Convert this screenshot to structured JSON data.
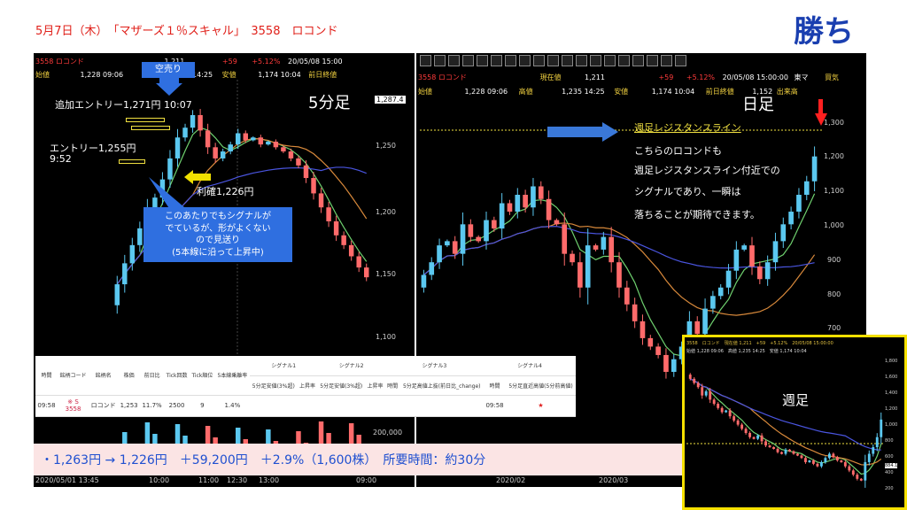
{
  "title": "5月7日（木）　「マザーズ１％スキャル」　3558　ロコンド",
  "verdict": "勝ち",
  "five_min_panel": {
    "label": "5分足",
    "header": {
      "code": "3558",
      "name": "ロコンド",
      "open_label": "始値",
      "open": "1,228 09:06",
      "price": "1,211",
      "change": "+59",
      "change_pct": "+5.12%",
      "datetime": "20/05/08 15:00",
      "high": "1,235 14:25",
      "low_label": "安値",
      "low": "1,174 10:04",
      "prev_close_label": "前日終値"
    },
    "price_tag": "1,287.4",
    "y_ticks": [
      "1,250",
      "1,200",
      "1,150",
      "1,100"
    ],
    "volume_tick": "200,000",
    "x_ticks": [
      "2020/05/01 13:45",
      "10:00",
      "11:00",
      "12:30",
      "13:00",
      "09:00"
    ],
    "annotations": {
      "short_sell": "空売り",
      "add_entry": "追加エントリー1,271円 10:07",
      "entry_line1": "エントリー1,255円",
      "entry_line2": "9:52",
      "exit": "利確1,226円",
      "callout": "このあたりでもシグナルが\nでているが、形がよくない\nので見送り\n(5本線に沿って上昇中)"
    }
  },
  "daily_panel": {
    "label": "日足",
    "header": {
      "code": "3558",
      "name": "ロコンド",
      "open_label": "始値",
      "open": "1,228 09:06",
      "price_label": "現在値",
      "price": "1,211",
      "high_label": "高値",
      "high": "1,235 14:25",
      "change": "+59",
      "change_pct": "+5.12%",
      "datetime": "20/05/08 15:00:00",
      "low_label": "安値",
      "low": "1,174 10:04",
      "prev_close_label": "前日終値",
      "prev_close": "1,152",
      "market": "東マ",
      "volume_label": "出来高",
      "trade_label": "買気"
    },
    "y_ticks": [
      "1,300",
      "1,200",
      "1,100",
      "1,000",
      "900",
      "800",
      "700"
    ],
    "x_ticks": [
      "2020/02",
      "2020/03"
    ],
    "resistance_label": "週足レジスタンスライン",
    "note_lines": [
      "こちらのロコンドも",
      "週足レジスタンスライン付近での",
      "シグナルであり、一瞬は",
      "落ちることが期待できます。"
    ]
  },
  "weekly_panel": {
    "label": "週足",
    "header_top": "3558　ロコンド　現在値 1,211　+59　+5.12%　20/05/08 15:00:00",
    "header_bottom": "始値 1,228 09:06　高値 1,235 14:25　安値 1,174 10:04",
    "y_ticks": [
      "1,800",
      "1,600",
      "1,400",
      "1,200",
      "1,000",
      "800",
      "600",
      "400",
      "200"
    ],
    "price_tag": "884.1"
  },
  "signal_table": {
    "headers": [
      "時間",
      "銘柄コード",
      "銘柄名",
      "株価",
      "前日比",
      "Tick回数",
      "Tick順位",
      "5本線乗離率"
    ],
    "signal_groups": [
      "シグナル1",
      "シグナル2",
      "シグナル3",
      "シグナル4"
    ],
    "sub_headers": [
      "5分足安値(3%超)",
      "上昇率",
      "5分足安値(3%超)",
      "上昇率",
      "時間",
      "5分足高値上抜(前日比_change)",
      "時間",
      "5分足直近高値(5分前高値)"
    ],
    "row": {
      "time": "09:58",
      "code": "3558",
      "code_mark": "※ S",
      "name": "ロコンド",
      "price": "1,253",
      "change": "11.7%",
      "tick_count": "2500",
      "tick_rank": "9",
      "deviation": "1.4%",
      "signal4_time": "09:58",
      "signal4_mark": "★"
    }
  },
  "result_line": "・1,263円 → 1,226円　＋59,200円　＋2.9%（1,600株）　所要時間：約30分",
  "colors": {
    "title_red": "#e0201a",
    "verdict_blue": "#1a3fb0",
    "callout_blue": "#2f6fe0",
    "up_candle": "#5bc8f0",
    "down_candle": "#ff6b6b",
    "ma_short": "#6fd16f",
    "ma_mid": "#d8893b",
    "ma_long": "#4a55e0",
    "resistance": "#f0e040",
    "result_bg": "#fbe4e4",
    "result_text": "#2050d0"
  },
  "chart_data": [
    {
      "type": "candlestick",
      "title": "5分足",
      "ylim": [
        1100,
        1290
      ],
      "series": [
        {
          "name": "close",
          "values": [
            1150,
            1165,
            1178,
            1190,
            1205,
            1212,
            1225,
            1240,
            1255,
            1262,
            1271,
            1260,
            1248,
            1240,
            1245,
            1250,
            1258,
            1253,
            1255,
            1250,
            1252,
            1248,
            1245,
            1240,
            1235,
            1226,
            1215,
            1205,
            1195,
            1185,
            1178,
            1170,
            1162,
            1155
          ]
        }
      ]
    },
    {
      "type": "candlestick",
      "title": "日足",
      "ylim": [
        700,
        1330
      ],
      "series": [
        {
          "name": "close",
          "values": [
            930,
            960,
            1000,
            1010,
            980,
            1050,
            1020,
            1010,
            1060,
            1040,
            1100,
            1080,
            1120,
            1090,
            1140,
            1110,
            1060,
            1050,
            980,
            960,
            900,
            1000,
            990,
            1020,
            960,
            900,
            860,
            820,
            780,
            760,
            740,
            700,
            730,
            760,
            820,
            790,
            850,
            880,
            900,
            940,
            990,
            1000,
            950,
            920,
            960,
            1010,
            1050,
            1080,
            1120,
            1152,
            1211
          ]
        }
      ]
    },
    {
      "type": "candlestick",
      "title": "週足",
      "ylim": [
        200,
        1900
      ],
      "series": [
        {
          "name": "close",
          "values": [
            1700,
            1650,
            1600,
            1500,
            1550,
            1450,
            1400,
            1350,
            1300,
            1320,
            1250,
            1200,
            1150,
            1100,
            1050,
            1000,
            980,
            1020,
            950,
            900,
            880,
            860,
            820,
            800,
            850,
            830,
            800,
            780,
            750,
            700,
            720,
            680,
            650,
            700,
            750,
            800,
            760,
            720,
            700,
            650,
            600,
            550,
            500,
            480,
            700,
            800,
            880,
            1000,
            1211
          ]
        }
      ]
    }
  ]
}
